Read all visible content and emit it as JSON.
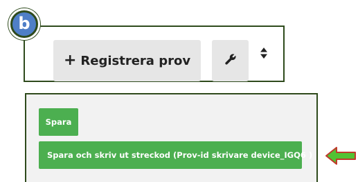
{
  "badge": {
    "label": "b"
  },
  "toolbar": {
    "register_icon": "+",
    "register_label": "Registrera prov",
    "wrench_icon": "wrench-icon",
    "sort_icon": "sort-icon"
  },
  "actions": {
    "save_label": "Spara",
    "save_print_label": "Spara och skriv ut streckod (Prov-id skrivare device_IGQ6 )"
  },
  "colors": {
    "panel_border": "#2e4a1c",
    "badge_fill": "#4f7fc7",
    "button_green": "#4caf50",
    "arrow_fill": "#52c234",
    "arrow_stroke": "#c0392b"
  }
}
